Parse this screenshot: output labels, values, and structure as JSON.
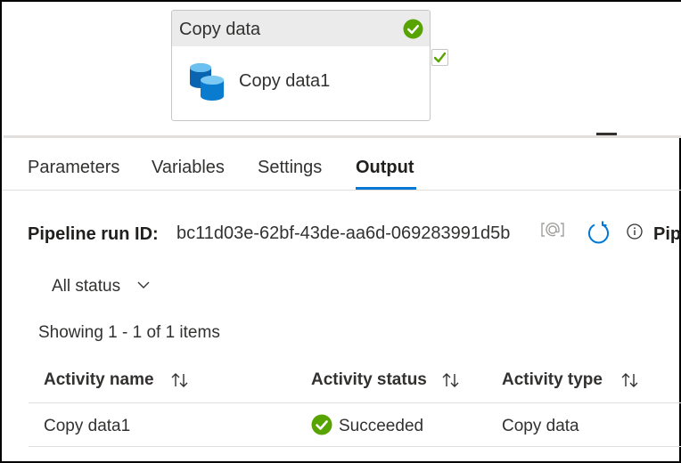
{
  "activity": {
    "header_title": "Copy data",
    "name": "Copy data1",
    "status_icon": "success-check-icon",
    "icon": "database-icon"
  },
  "tabs": [
    {
      "label": "Parameters"
    },
    {
      "label": "Variables"
    },
    {
      "label": "Settings"
    },
    {
      "label": "Output",
      "active": true
    }
  ],
  "run": {
    "label": "Pipeline run ID:",
    "value": "bc11d03e-62bf-43de-aa6d-069283991d5b",
    "truncated_label": "Pip"
  },
  "filter": {
    "selected": "All status"
  },
  "summary": "Showing 1 - 1 of 1 items",
  "table": {
    "columns": [
      "Activity name",
      "Activity status",
      "Activity type"
    ],
    "rows": [
      {
        "name": "Copy data1",
        "status": "Succeeded",
        "type": "Copy data"
      }
    ]
  },
  "colors": {
    "accent": "#0078d4",
    "success": "#57a300",
    "database": "#0a7ccf"
  }
}
